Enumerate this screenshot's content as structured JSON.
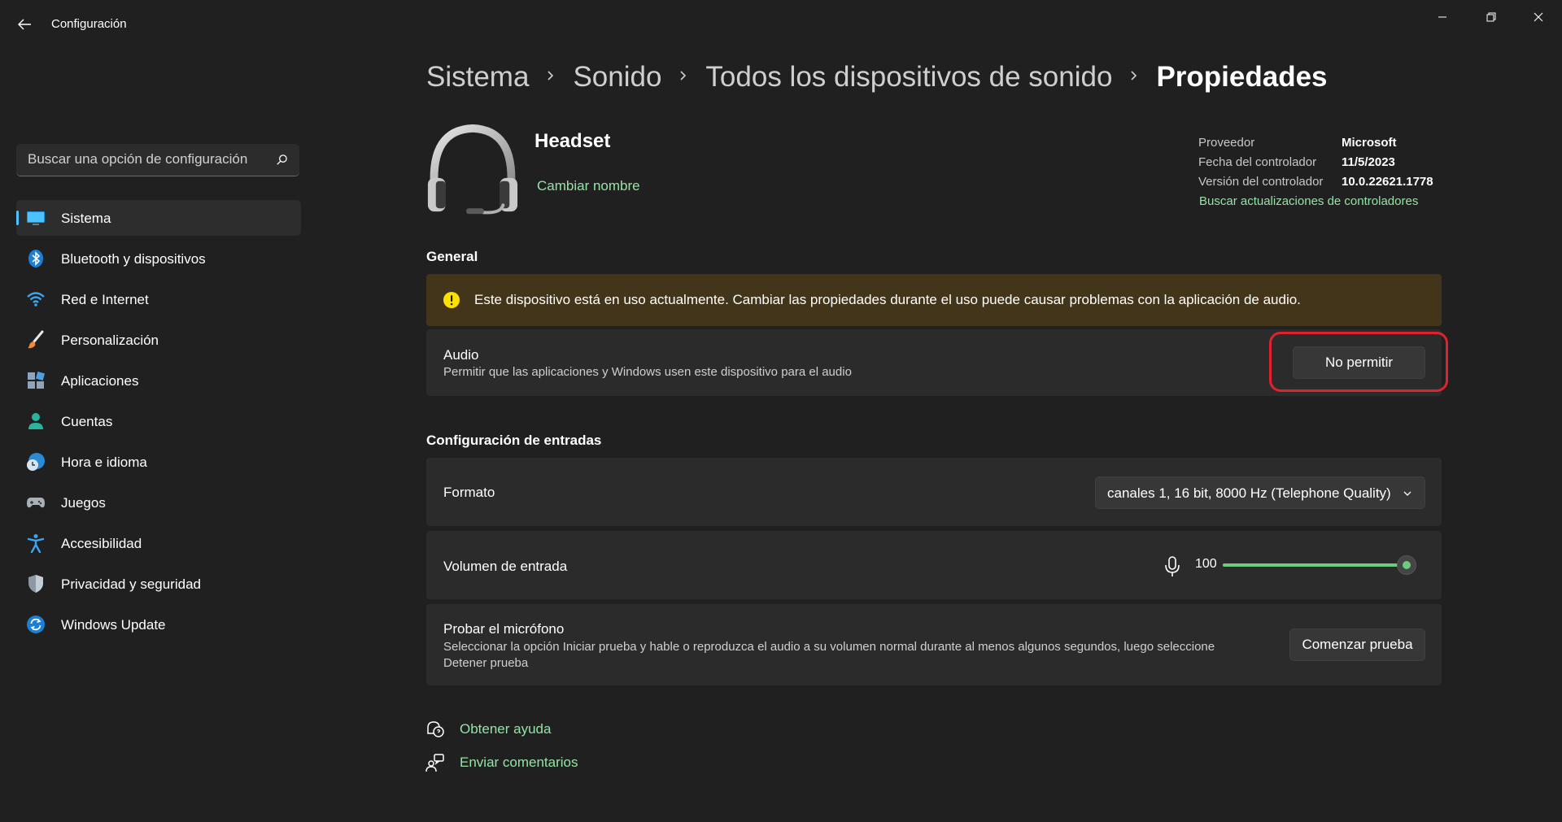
{
  "window": {
    "title": "Configuración",
    "back_icon": "arrow-left-icon",
    "controls": [
      "minimize-icon",
      "restore-icon",
      "close-icon"
    ]
  },
  "sidebar": {
    "search_placeholder": "Buscar una opción de configuración",
    "search_icon": "search-icon",
    "active_indicator_color": "#4cc2ff",
    "items": [
      {
        "label": "Sistema",
        "icon": "monitor-icon",
        "active": true
      },
      {
        "label": "Bluetooth y dispositivos",
        "icon": "bluetooth-icon",
        "active": false
      },
      {
        "label": "Red e Internet",
        "icon": "wifi-icon",
        "active": false
      },
      {
        "label": "Personalización",
        "icon": "paintbrush-icon",
        "active": false
      },
      {
        "label": "Aplicaciones",
        "icon": "apps-icon",
        "active": false
      },
      {
        "label": "Cuentas",
        "icon": "person-icon",
        "active": false
      },
      {
        "label": "Hora e idioma",
        "icon": "globe-clock-icon",
        "active": false
      },
      {
        "label": "Juegos",
        "icon": "gamepad-icon",
        "active": false
      },
      {
        "label": "Accesibilidad",
        "icon": "accessibility-icon",
        "active": false
      },
      {
        "label": "Privacidad y seguridad",
        "icon": "shield-icon",
        "active": false
      },
      {
        "label": "Windows Update",
        "icon": "update-icon",
        "active": false
      }
    ]
  },
  "breadcrumb": {
    "items": [
      "Sistema",
      "Sonido",
      "Todos los dispositivos de sonido"
    ],
    "current": "Propiedades"
  },
  "device": {
    "icon": "headset-icon",
    "name": "Headset",
    "rename_label": "Cambiar nombre",
    "driver": {
      "provider_label": "Proveedor",
      "provider_value": "Microsoft",
      "date_label": "Fecha del controlador",
      "date_value": "11/5/2023",
      "version_label": "Versión del controlador",
      "version_value": "10.0.22621.1778",
      "update_link": "Buscar actualizaciones de controladores"
    }
  },
  "general": {
    "title": "General",
    "warning_icon": "warning-icon",
    "warning_text": "Este dispositivo está en uso actualmente. Cambiar las propiedades durante el uso puede causar problemas con la aplicación de audio.",
    "audio_title": "Audio",
    "audio_desc": "Permitir que las aplicaciones y Windows usen este dispositivo para el audio",
    "audio_button": "No permitir"
  },
  "input_settings": {
    "title": "Configuración de entradas",
    "format_label": "Formato",
    "format_value": "canales 1, 16 bit, 8000 Hz (Telephone Quality)",
    "volume_label": "Volumen de entrada",
    "volume_value": "100",
    "volume_level": 100,
    "accent_color": "#6ccb7c",
    "test_title": "Probar el micrófono",
    "test_desc": "Seleccionar la opción Iniciar prueba y hable o reproduzca el audio a su volumen normal durante al menos algunos segundos, luego seleccione Detener prueba",
    "test_button": "Comenzar prueba"
  },
  "footer": {
    "help": "Obtener ayuda",
    "help_icon": "help-chat-icon",
    "feedback": "Enviar comentarios",
    "feedback_icon": "feedback-icon"
  }
}
